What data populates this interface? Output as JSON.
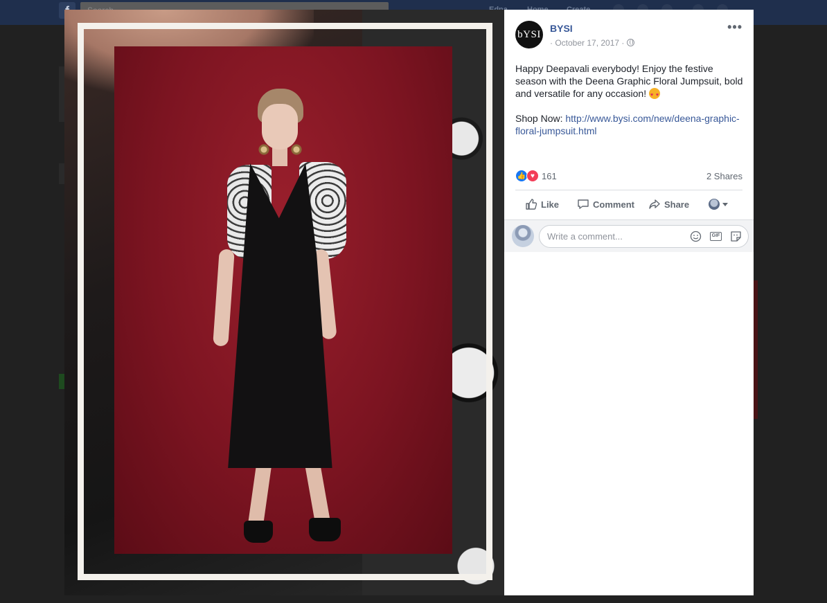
{
  "background": {
    "search_placeholder": "Search",
    "nav_items": [
      "Edna",
      "Home",
      "Create"
    ]
  },
  "photo": {
    "alt": "Model in black dress with floral lace sleeves against red backdrop"
  },
  "post": {
    "avatar_text": "bYSI",
    "page_name": "BYSI",
    "timestamp": "· October 17, 2017 ·",
    "more_label": "•••",
    "message_line": "Happy Deepavali everybody! Enjoy the festive season with the Deena Graphic Floral Jumpsuit, bold and versatile for any occasion!",
    "shop_label": "Shop Now:",
    "shop_url": "http://www.bysi.com/new/deena-graphic-floral-jumpsuit.html",
    "reaction_count": "161",
    "shares": "2 Shares",
    "actions": {
      "like": "Like",
      "comment": "Comment",
      "share": "Share"
    },
    "comment_placeholder": "Write a comment..."
  },
  "colors": {
    "link": "#385898",
    "like_blue": "#1877f2",
    "love_red": "#f33e58",
    "text": "#1d2129",
    "muted": "#606770"
  }
}
